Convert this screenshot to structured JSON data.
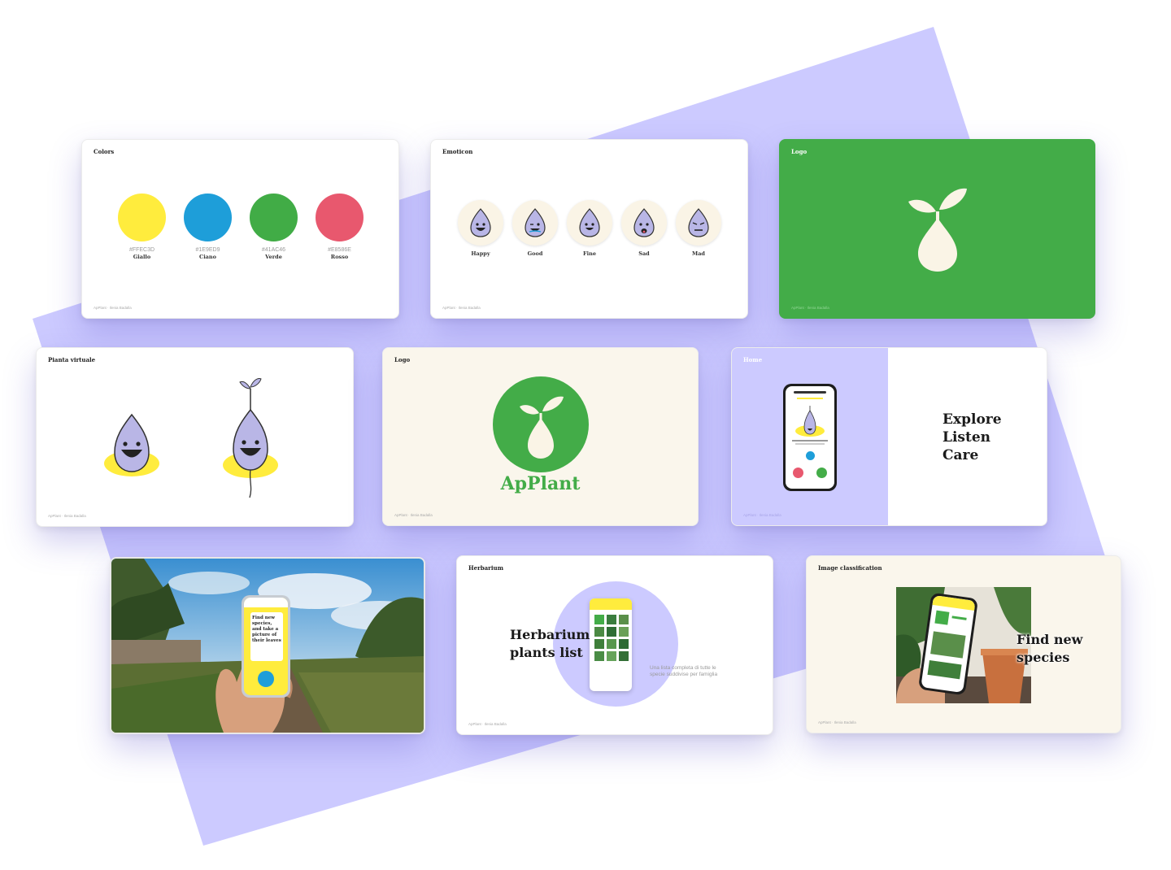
{
  "colors_card": {
    "title": "Colors",
    "footer": "ApPlant · Ilenia Badalla",
    "swatches": [
      {
        "hex": "#FFEC3D",
        "name": "Giallo",
        "color": "#FFEC3D"
      },
      {
        "hex": "#1E9ED9",
        "name": "Ciano",
        "color": "#1E9ED9"
      },
      {
        "hex": "#41AC46",
        "name": "Verde",
        "color": "#41AC46"
      },
      {
        "hex": "#E8586E",
        "name": "Rosso",
        "color": "#E8586E"
      }
    ]
  },
  "emoticon_card": {
    "title": "Emoticon",
    "footer": "ApPlant · Ilenia Badalla",
    "items": [
      {
        "label": "Happy"
      },
      {
        "label": "Good"
      },
      {
        "label": "Fine"
      },
      {
        "label": "Sad"
      },
      {
        "label": "Mad"
      }
    ]
  },
  "logo_green_card": {
    "title": "Logo",
    "footer": "ApPlant · Ilenia Badalla",
    "background": "#43AC48"
  },
  "virtual_plant_card": {
    "title": "Pianta virtuale",
    "footer": "ApPlant · Ilenia Badalla"
  },
  "logo_cream_card": {
    "title": "Logo",
    "brand": "ApPlant",
    "footer": "ApPlant · Ilenia Badalla",
    "background": "#FAF6EC"
  },
  "home_card": {
    "title": "Home",
    "footer": "ApPlant · Ilenia Badalla",
    "lines": [
      "Explore",
      "Listen",
      "Care"
    ],
    "accent": "#CCCAFF"
  },
  "photo_card": {
    "phone_text": "Find new species, and take a picture of their leaves"
  },
  "herbarium_card": {
    "title": "Herbarium",
    "heading_line1": "Herbarium",
    "heading_line2": "plants list",
    "description": "Una lista completa di tutte le specie suddivise per famiglia",
    "footer": "ApPlant · Ilenia Badalla"
  },
  "image_class_card": {
    "title": "Image classification",
    "heading_line1": "Find new",
    "heading_line2": "species",
    "footer": "ApPlant · Ilenia Badalla",
    "background": "#FAF6EC"
  },
  "theme": {
    "purple": "#CCCAFF",
    "green": "#43AC48",
    "cream": "#FAF6EC",
    "yellow": "#FFEC3D"
  }
}
